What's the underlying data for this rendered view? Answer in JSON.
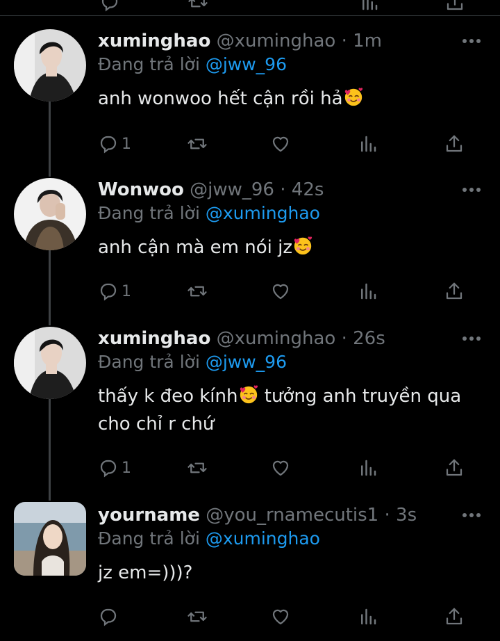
{
  "tweets": [
    {
      "name": "xuminghao",
      "handle": "@xuminghao",
      "time": "1m",
      "reply_prefix": "Đang trả lời ",
      "reply_to": "@jww_96",
      "text": "anh wonwoo hết cận rồi hả",
      "emoji": "smiling-face-with-hearts",
      "text2": "",
      "text_line2": "",
      "reply_count": "1"
    },
    {
      "name": "Wonwoo",
      "handle": "@jww_96",
      "time": "42s",
      "reply_prefix": "Đang trả lời ",
      "reply_to": "@xuminghao",
      "text": "anh cận mà em nói jz",
      "emoji": "smiling-face-with-hearts",
      "text2": "",
      "text_line2": "",
      "reply_count": "1"
    },
    {
      "name": "xuminghao",
      "handle": "@xuminghao",
      "time": "26s",
      "reply_prefix": "Đang trả lời ",
      "reply_to": "@jww_96",
      "text": "thấy k đeo kính",
      "emoji": "smiling-face-with-hearts",
      "text2": " tưởng anh truyền qua",
      "text_line2": "cho chỉ r chứ",
      "reply_count": "1"
    },
    {
      "name": "yourname",
      "handle": "@you_rnamecutis1",
      "time": "3s",
      "reply_prefix": "Đang trả lời ",
      "reply_to": "@xuminghao",
      "text": "jz em=)))?",
      "emoji": "",
      "text2": "",
      "text_line2": "",
      "reply_count": ""
    }
  ],
  "icons": [
    "reply-icon",
    "retweet-icon",
    "like-icon",
    "views-icon",
    "share-icon",
    "more-icon"
  ],
  "colors": {
    "background": "#000000",
    "text": "#e7e9ea",
    "secondary": "#71767b",
    "mention": "#1d9bf0",
    "thread_line": "#3e4144"
  }
}
